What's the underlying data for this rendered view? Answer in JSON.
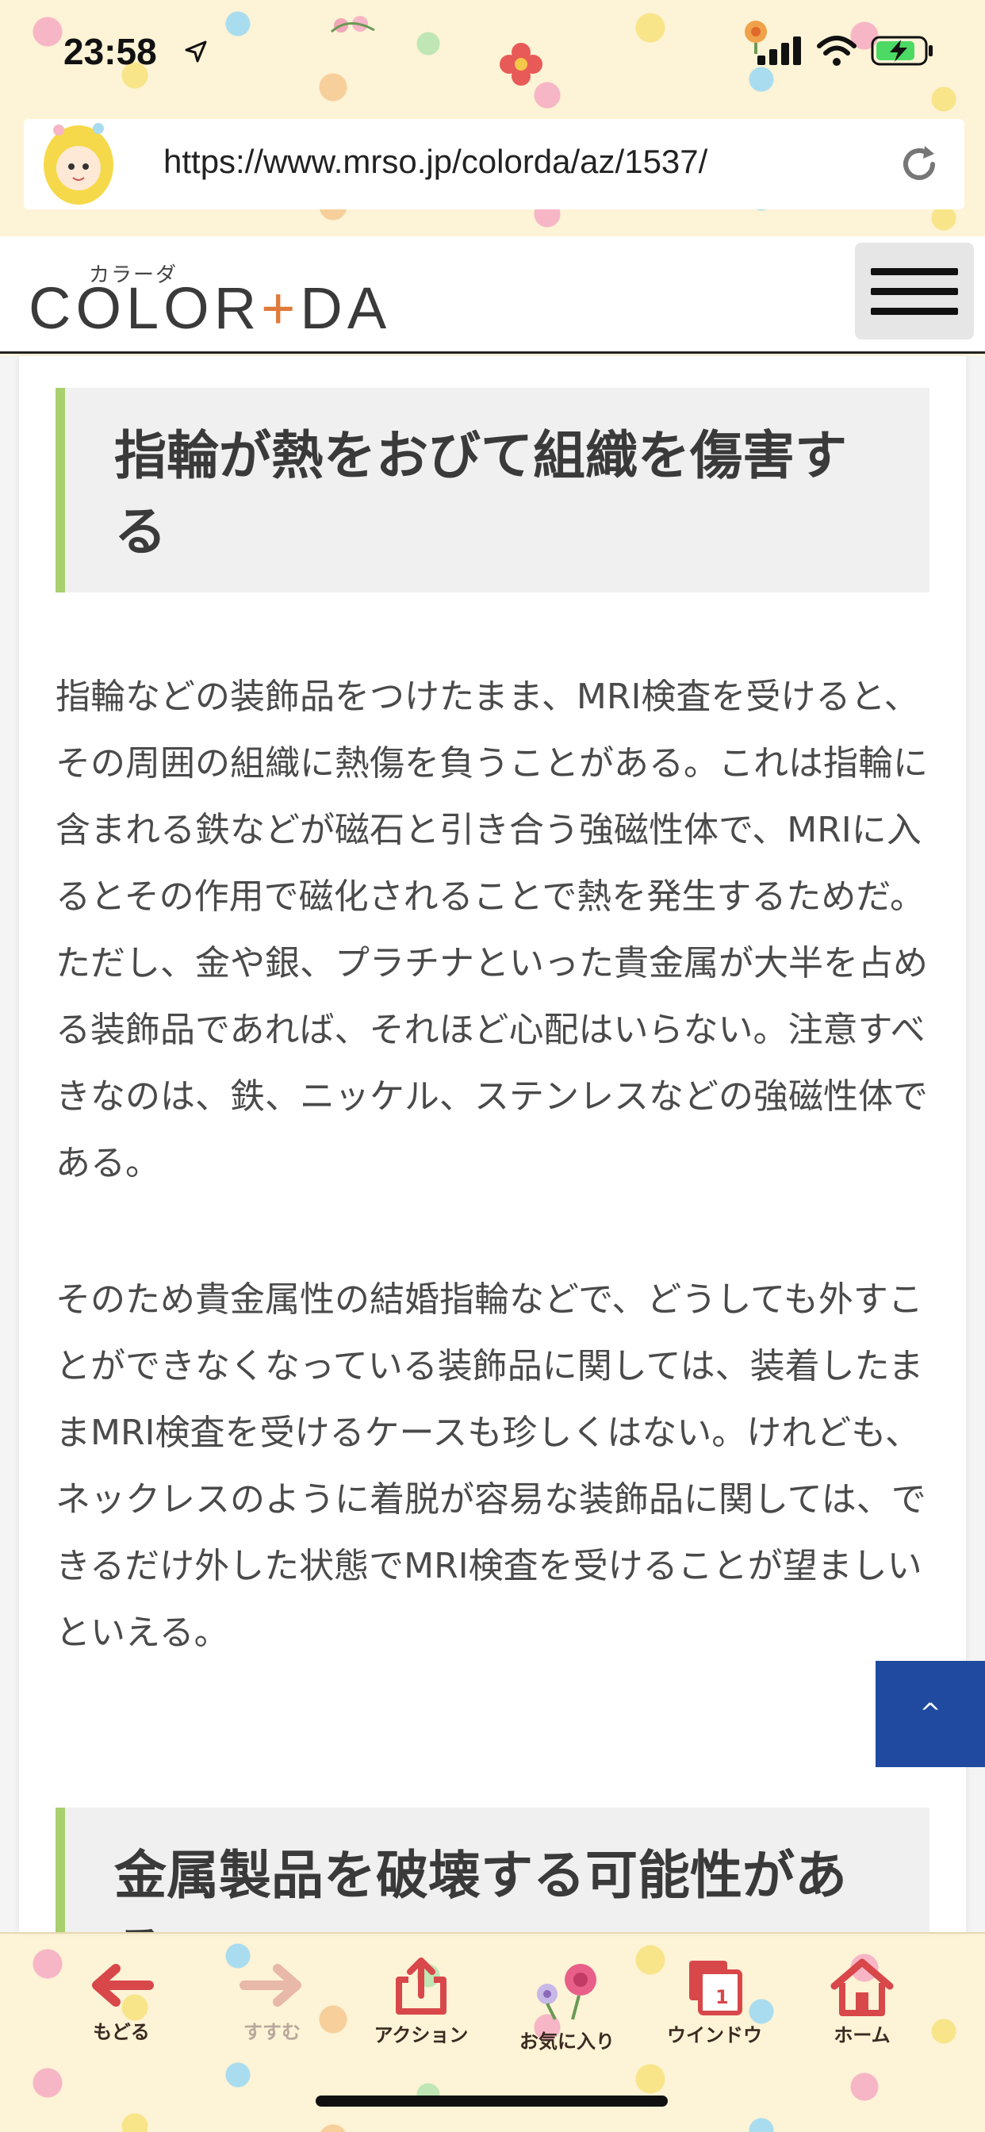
{
  "status_bar": {
    "time": "23:58"
  },
  "browser": {
    "url": "https://www.mrso.jp/colorda/az/1537/"
  },
  "site": {
    "logo_kana": "カラーダ",
    "logo_word_a": "COLOR",
    "logo_plus": "+",
    "logo_word_b": "DA"
  },
  "article": {
    "heading_1": "指輪が熱をおびて組織を傷害する",
    "paragraph_1": "指輪などの装飾品をつけたまま、MRI検査を受けると、その周囲の組織に熱傷を負うことがある。これは指輪に含まれる鉄などが磁石と引き合う強磁性体で、MRIに入るとその作用で磁化されることで熱を発生するためだ。ただし、金や銀、プラチナといった貴金属が大半を占める装飾品であれば、それほど心配はいらない。注意すべきなのは、鉄、ニッケル、ステンレスなどの強磁性体である。",
    "paragraph_2": "そのため貴金属性の結婚指輪などで、どうしても外すことができなくなっている装飾品に関しては、装着したままMRI検査を受けるケースも珍しくはない。けれども、ネックレスのように着脱が容易な装飾品に関しては、できるだけ外した状態でMRI検査を受けることが望ましいといえる。",
    "heading_2": "金属製品を破壊する可能性がある"
  },
  "to_top_label": "^",
  "toolbar": {
    "back": "もどる",
    "forward": "すすむ",
    "action": "アクション",
    "favorites": "お気に入り",
    "window": "ウインドウ",
    "window_count": "1",
    "home": "ホーム"
  },
  "colors": {
    "accent_green": "#a9cf6f",
    "to_top_blue": "#1f4aa0",
    "toolbar_red": "#d8474a"
  },
  "icons": [
    "location-arrow-icon",
    "signal-icon",
    "wifi-icon",
    "battery-charging-icon",
    "reload-icon",
    "hamburger-menu-icon",
    "back-arrow-icon",
    "forward-arrow-icon",
    "share-icon",
    "flower-icon",
    "window-icon",
    "home-icon"
  ]
}
